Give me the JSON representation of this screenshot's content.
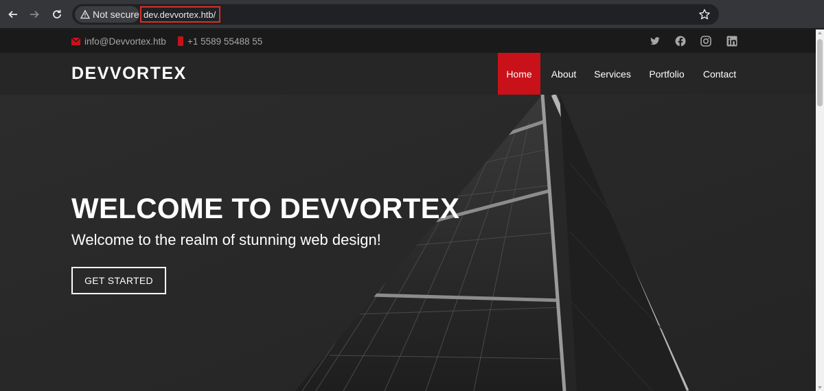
{
  "browser": {
    "security_label": "Not secure",
    "url": "dev.devvortex.htb/",
    "icons": [
      "back-icon",
      "forward-icon",
      "reload-icon",
      "warning-icon",
      "star-icon"
    ]
  },
  "topbar": {
    "email": "info@Devvortex.htb",
    "phone": "+1 5589 55488 55",
    "social_icons": [
      "twitter-icon",
      "facebook-icon",
      "instagram-icon",
      "linkedin-icon"
    ]
  },
  "header": {
    "logo": "DEVVORTEX",
    "nav": [
      {
        "label": "Home",
        "active": true
      },
      {
        "label": "About",
        "active": false
      },
      {
        "label": "Services",
        "active": false
      },
      {
        "label": "Portfolio",
        "active": false
      },
      {
        "label": "Contact",
        "active": false
      }
    ]
  },
  "hero": {
    "title": "WELCOME TO DEVVORTEX",
    "subtitle": "Welcome to the realm of stunning web design!",
    "cta": "GET STARTED"
  },
  "colors": {
    "accent": "#c9111a",
    "header_bg": "#262626",
    "topbar_bg": "#1a1a1a",
    "url_highlight": "#d93025"
  }
}
